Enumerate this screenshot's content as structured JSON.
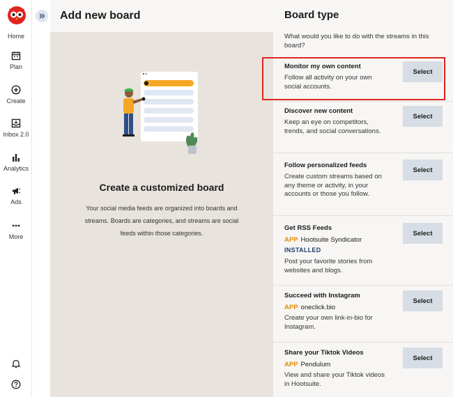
{
  "rail": {
    "items": [
      {
        "label": "Home",
        "icon": "home-icon"
      },
      {
        "label": "Plan",
        "icon": "calendar-icon"
      },
      {
        "label": "Create",
        "icon": "plus-circle-icon"
      },
      {
        "label": "Inbox 2.0",
        "icon": "inbox-icon"
      },
      {
        "label": "Analytics",
        "icon": "bar-chart-icon"
      },
      {
        "label": "Ads",
        "icon": "megaphone-icon"
      },
      {
        "label": "More",
        "icon": "more-dots-icon"
      }
    ],
    "bottom": [
      {
        "icon": "bell-icon"
      },
      {
        "icon": "help-icon"
      }
    ]
  },
  "main": {
    "title": "Add new board",
    "cta_title": "Create a customized board",
    "cta_desc": "Your social media feeds are organized into boards and streams. Boards are categories, and streams are social feeds within those categories."
  },
  "right": {
    "title": "Board type",
    "subtitle": "What would you like to do with the streams in this board?",
    "select_label": "Select",
    "options": [
      {
        "title": "Monitor my own content",
        "desc": "Follow all activity on your own social accounts."
      },
      {
        "title": "Discover new content",
        "desc": "Keep an eye on competitors, trends, and social conversations."
      },
      {
        "title": "Follow personalized feeds",
        "desc": "Create custom streams based on any theme or activity, in your accounts or those you follow."
      },
      {
        "title": "Get RSS Feeds",
        "app_tag": "APP",
        "app_name": "Hootsuite Syndicator",
        "installed": "INSTALLED",
        "desc": "Post your favorite stories from websites and blogs."
      },
      {
        "title": "Succeed with Instagram",
        "app_tag": "APP",
        "app_name": "oneclick.bio",
        "desc": "Create your own link-in-bio for Instagram."
      },
      {
        "title": "Share your Tiktok Videos",
        "app_tag": "APP",
        "app_name": "Pendulum",
        "desc": "View and share your Tiktok videos in Hootsuite."
      }
    ]
  },
  "colors": {
    "accent_red": "#e0241f",
    "app_orange": "#e68a00",
    "select_bg": "#d7dde4",
    "installed_blue": "#1d3f73"
  }
}
